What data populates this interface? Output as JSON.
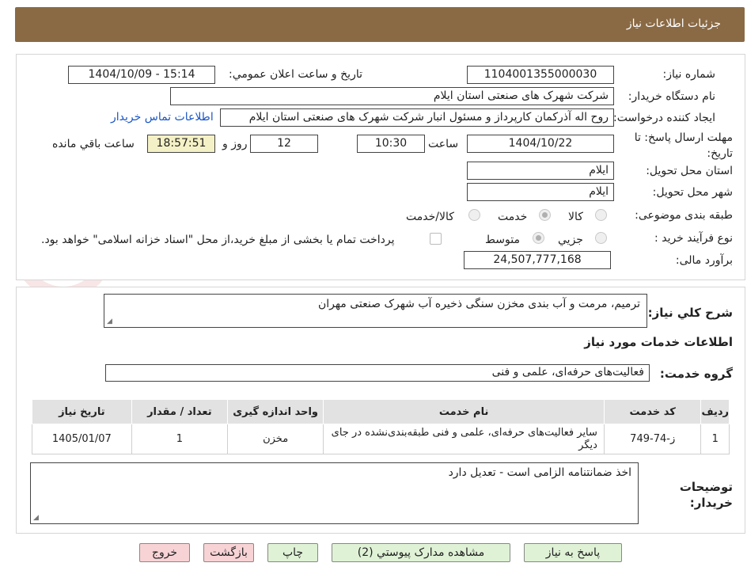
{
  "header": {
    "title": "جزئیات اطلاعات نیاز"
  },
  "watermark": {
    "text": "AriaTender.net"
  },
  "form": {
    "need_number_label": "شماره نیاز:",
    "need_number": "1104001355000030",
    "announce_label": "تاریخ و ساعت اعلان عمومي:",
    "announce_value": "1404/10/09 - 15:14",
    "buyer_org_label": "نام دستگاه خریدار:",
    "buyer_org": "شرکت شهرک های صنعتی استان ایلام",
    "creator_label": "ایجاد کننده درخواست:",
    "creator": "روح اله آذرکمان کارپرداز و مسئول انبار شرکت شهرک های صنعتی استان ایلام",
    "contact_link": "اطلاعات تماس خریدار",
    "deadline_label": "مهلت ارسال پاسخ: تا تاریخ:",
    "deadline_date": "1404/10/22",
    "time_label": "ساعت",
    "deadline_time": "10:30",
    "days": "12",
    "days_label": "روز و",
    "remaining": "18:57:51",
    "remaining_label": "ساعت باقي مانده",
    "province_label": "استان محل تحویل:",
    "province": "ایلام",
    "city_label": "شهر محل تحویل:",
    "city": "ایلام",
    "category_label": "طبقه بندی موضوعی:",
    "category_options": [
      "کالا",
      "خدمت",
      "کالا/خدمت"
    ],
    "process_label": "نوع فرآیند خرید :",
    "process_options": [
      "جزیي",
      "متوسط"
    ],
    "payment_note": "پرداخت تمام یا بخشی از مبلغ خرید،از محل \"اسناد خزانه اسلامی\" خواهد بود.",
    "budget_label": "برآورد مالی:",
    "budget": "24,507,777,168"
  },
  "details": {
    "description_label": "شرح کلي نیاز:",
    "description": "ترمیم، مرمت و آب بندی مخزن سنگی ذخیره آب شهرک صنعتی مهران",
    "services_heading": "اطلاعات خدمات مورد نیاز",
    "service_group_label": "گروه خدمت:",
    "service_group": "فعالیت‌های حرفه‌ای، علمی و فنی",
    "table": {
      "headers": [
        "ردیف",
        "کد خدمت",
        "نام خدمت",
        "واحد اندازه گیری",
        "تعداد / مقدار",
        "تاریخ نیاز"
      ],
      "rows": [
        [
          "1",
          "ز-74-749",
          "سایر فعالیت‌های حرفه‌ای، علمی و فنی طبقه‌بندی‌نشده در جای دیگر",
          "مخزن",
          "1",
          "1405/01/07"
        ]
      ]
    },
    "buyer_notes_label": "توضیحات خریدار:",
    "buyer_notes": "اخذ ضمانتنامه الزامی است - تعدیل دارد"
  },
  "buttons": {
    "reply": "پاسخ به نیاز",
    "attachments": "مشاهده مدارک پیوستي (2)",
    "print": "چاپ",
    "back": "بازگشت",
    "exit": "خروج"
  }
}
